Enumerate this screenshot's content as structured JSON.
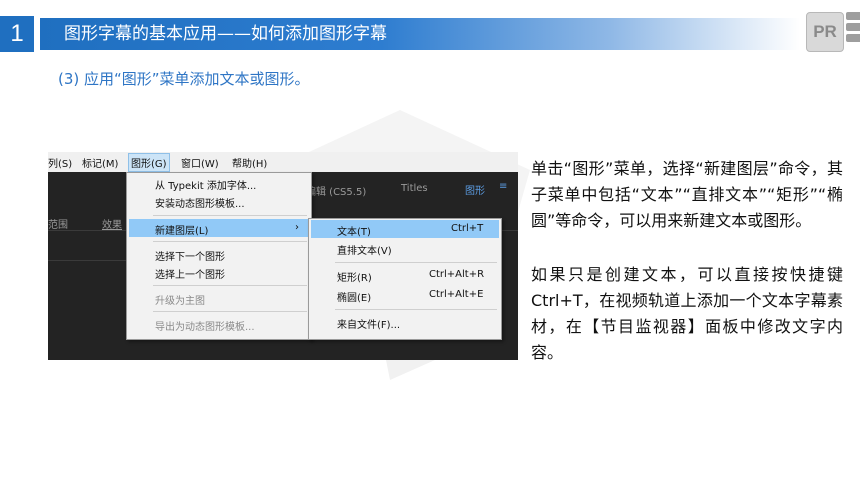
{
  "header": {
    "number": "1",
    "title": "图形字幕的基本应用——如何添加图形字幕",
    "logo_text": "PR"
  },
  "subtitle": "(3) 应用“图形”菜单添加文本或图形。",
  "screenshot": {
    "menubar": {
      "items": [
        "列(S)",
        "标记(M)",
        "图形(G)",
        "窗口(W)",
        "帮助(H)"
      ]
    },
    "panel": {
      "edit_label": "编辑 (CS5.5)",
      "titles_label": "Titles",
      "graphics_label": "图形",
      "menu_icon": "≡",
      "range_label": "范围",
      "effects_label": "效果"
    },
    "graphics_menu": {
      "items": [
        "从 Typekit 添加字体...",
        "安装动态图形模板...",
        "新建图层(L)",
        "选择下一个图形",
        "选择上一个图形",
        "升级为主图",
        "导出为动态图形模板..."
      ],
      "submenu_arrow": "›"
    },
    "new_layer_submenu": {
      "items": [
        {
          "label": "文本(T)",
          "shortcut": "Ctrl+T"
        },
        {
          "label": "直排文本(V)",
          "shortcut": ""
        },
        {
          "label": "矩形(R)",
          "shortcut": "Ctrl+Alt+R"
        },
        {
          "label": "椭圆(E)",
          "shortcut": "Ctrl+Alt+E"
        },
        {
          "label": "来自文件(F)...",
          "shortcut": ""
        }
      ]
    }
  },
  "description": {
    "para1": "单击“图形”菜单，选择“新建图层”命令，其子菜单中包括“文本”“直排文本”“矩形”“椭圆”等命令，可以用来新建文本或图形。",
    "para2": "如果只是创建文本，可以直接按快捷键Ctrl+T，在视频轨道上添加一个文本字幕素材，在【节目监视器】面板中修改文字内容。"
  }
}
